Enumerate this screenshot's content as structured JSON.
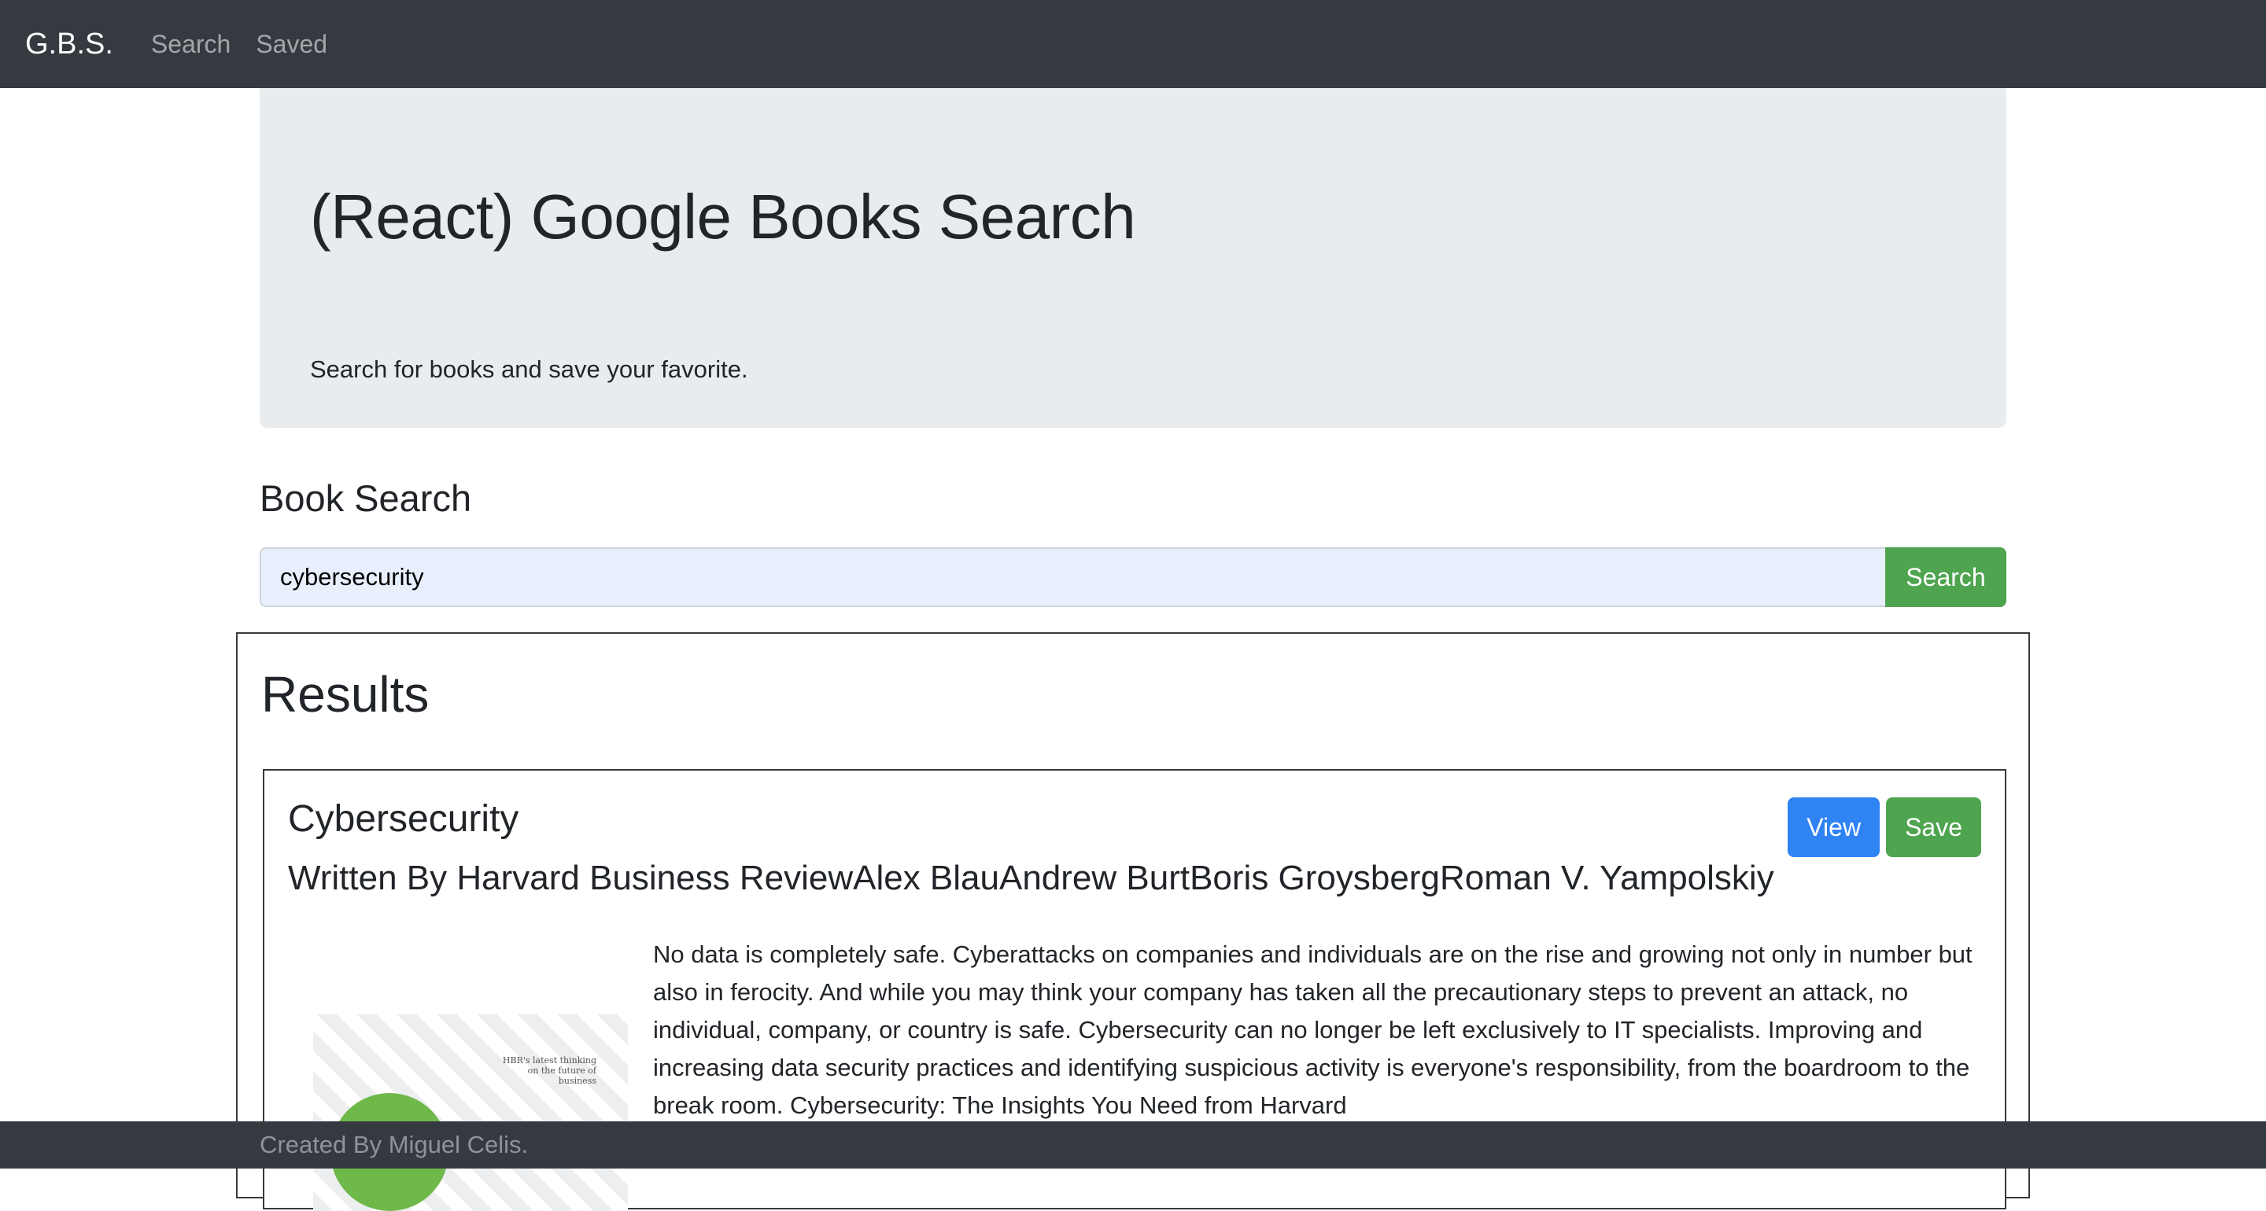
{
  "navbar": {
    "brand": "G.B.S.",
    "links": [
      "Search",
      "Saved"
    ]
  },
  "jumbotron": {
    "title": "(React) Google Books Search",
    "lead": "Search for books and save your favorite."
  },
  "search": {
    "heading": "Book Search",
    "value": "cybersecurity",
    "button_label": "Search"
  },
  "results": {
    "heading": "Results",
    "items": [
      {
        "title": "Cybersecurity",
        "authors": "Written By Harvard Business ReviewAlex BlauAndrew BurtBoris GroysbergRoman V. Yampolskiy",
        "view_label": "View",
        "save_label": "Save",
        "cover_tagline": "HBR's latest thinking on the future of business",
        "description": "No data is completely safe. Cyberattacks on companies and individuals are on the rise and growing not only in number but also in ferocity. And while you may think your company has taken all the precautionary steps to prevent an attack, no individual, company, or country is safe. Cybersecurity can no longer be left exclusively to IT specialists. Improving and increasing data security practices and identifying suspicious activity is everyone's responsibility, from the boardroom to the break room. Cybersecurity: The Insights You Need from Harvard"
      }
    ]
  },
  "footer": {
    "text": "Created By Miguel Celis."
  },
  "colors": {
    "navbar_bg": "#343a40",
    "jumbotron_bg": "#e9ecef",
    "success": "#4fa450",
    "primary": "#2f83f3",
    "input_bg": "#e8f0fe"
  }
}
